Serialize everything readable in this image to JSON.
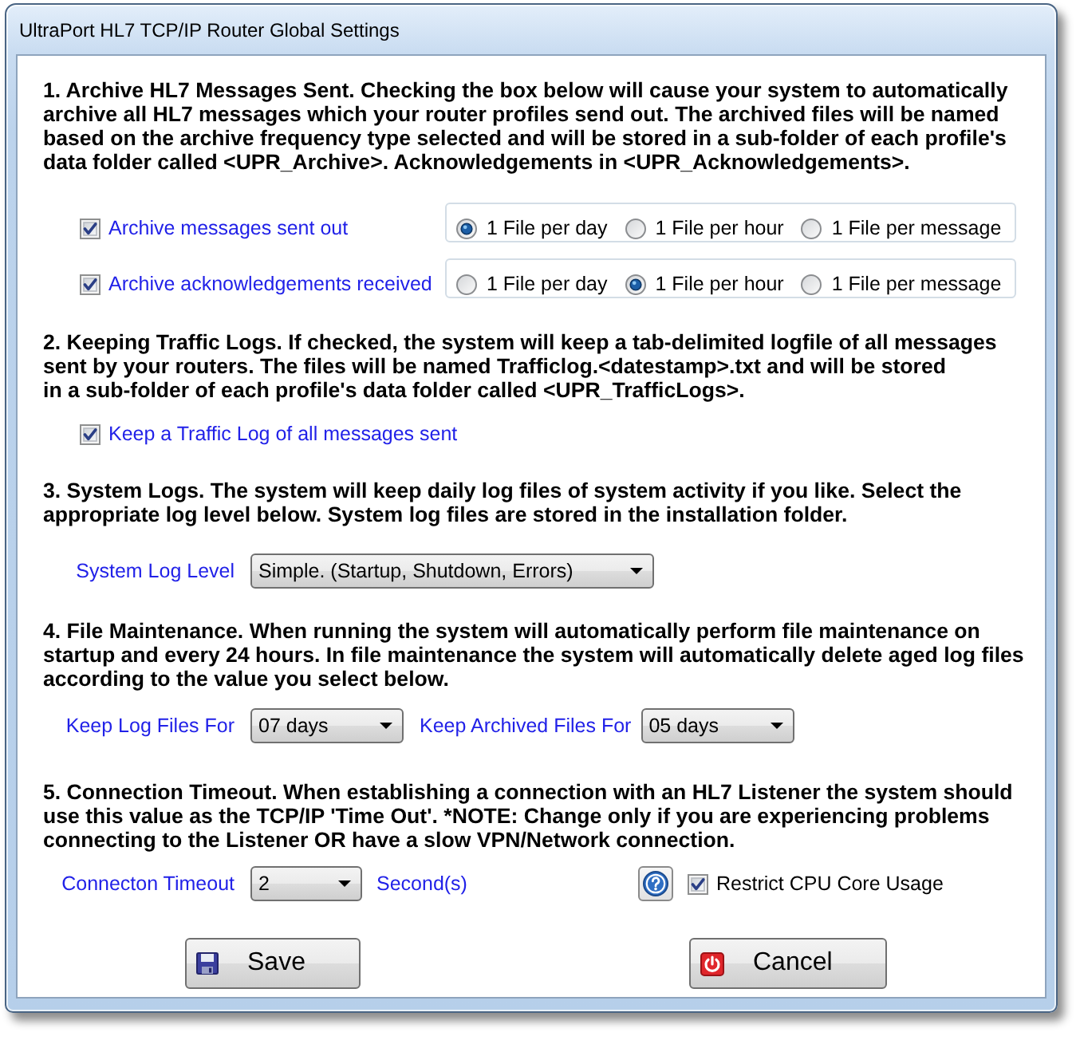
{
  "window": {
    "title": "UltraPort HL7 TCP/IP Router Global Settings"
  },
  "sections": [
    {
      "kind": "archive",
      "text": "1. Archive HL7 Messages Sent. Checking the box below will cause your system to automatically\narchive all HL7 messages which your router profiles send out. The archived files will be named\nbased on the archive frequency type selected and will be stored in a sub-folder of each profile's\ndata folder called <UPR_Archive>. Acknowledgements in <UPR_Acknowledgements>.",
      "rows": [
        {
          "label": "Archive messages sent out",
          "checked": true,
          "options": [
            {
              "label": "1 File per day",
              "selected": true
            },
            {
              "label": "1 File per hour",
              "selected": false
            },
            {
              "label": "1 File per message",
              "selected": false
            }
          ]
        },
        {
          "label": "Archive acknowledgements received",
          "checked": true,
          "options": [
            {
              "label": "1 File per day",
              "selected": false
            },
            {
              "label": "1 File per hour",
              "selected": true
            },
            {
              "label": "1 File per message",
              "selected": false
            }
          ]
        }
      ]
    },
    {
      "kind": "traffic",
      "text": "2. Keeping Traffic Logs. If checked, the system will keep a tab-delimited logfile of all messages\nsent by your routers. The files will be named Trafficlog.<datestamp>.txt and will be stored\nin a sub-folder of each profile's data folder called <UPR_TrafficLogs>.",
      "checkbox": {
        "label": "Keep a Traffic Log of all messages sent",
        "checked": true
      }
    },
    {
      "kind": "system_log",
      "text": "3. System Logs. The system will keep daily log files of system activity if you like. Select the\nappropriate log level below. System log files are stored in the installation folder.",
      "dropdowns": [
        {
          "label": "System Log Level",
          "value": "Simple. (Startup, Shutdown, Errors)"
        }
      ]
    },
    {
      "kind": "maintenance",
      "text": "4. File Maintenance. When running the system will automatically perform file maintenance on\nstartup and every 24 hours. In file maintenance the system will automatically delete aged log files\naccording to the value you select below.",
      "dropdowns": [
        {
          "label": "Keep Log Files For",
          "value": "07 days"
        },
        {
          "label": "Keep Archived Files For",
          "value": "05 days"
        }
      ]
    },
    {
      "kind": "timeout",
      "text": "5. Connection Timeout. When establishing a connection with an HL7 Listener the system should\nuse this value as the TCP/IP 'Time Out'. *NOTE: Change only if you are experiencing problems\nconnecting to the Listener OR have a slow VPN/Network connection.",
      "dropdowns": [
        {
          "label": "Connecton Timeout",
          "value": "2",
          "unit": "Second(s)"
        }
      ],
      "checkbox": {
        "label": "Restrict CPU Core Usage",
        "checked": true
      }
    }
  ],
  "buttons": [
    {
      "kind": "save",
      "label": "Save"
    },
    {
      "kind": "cancel",
      "label": "Cancel"
    }
  ]
}
